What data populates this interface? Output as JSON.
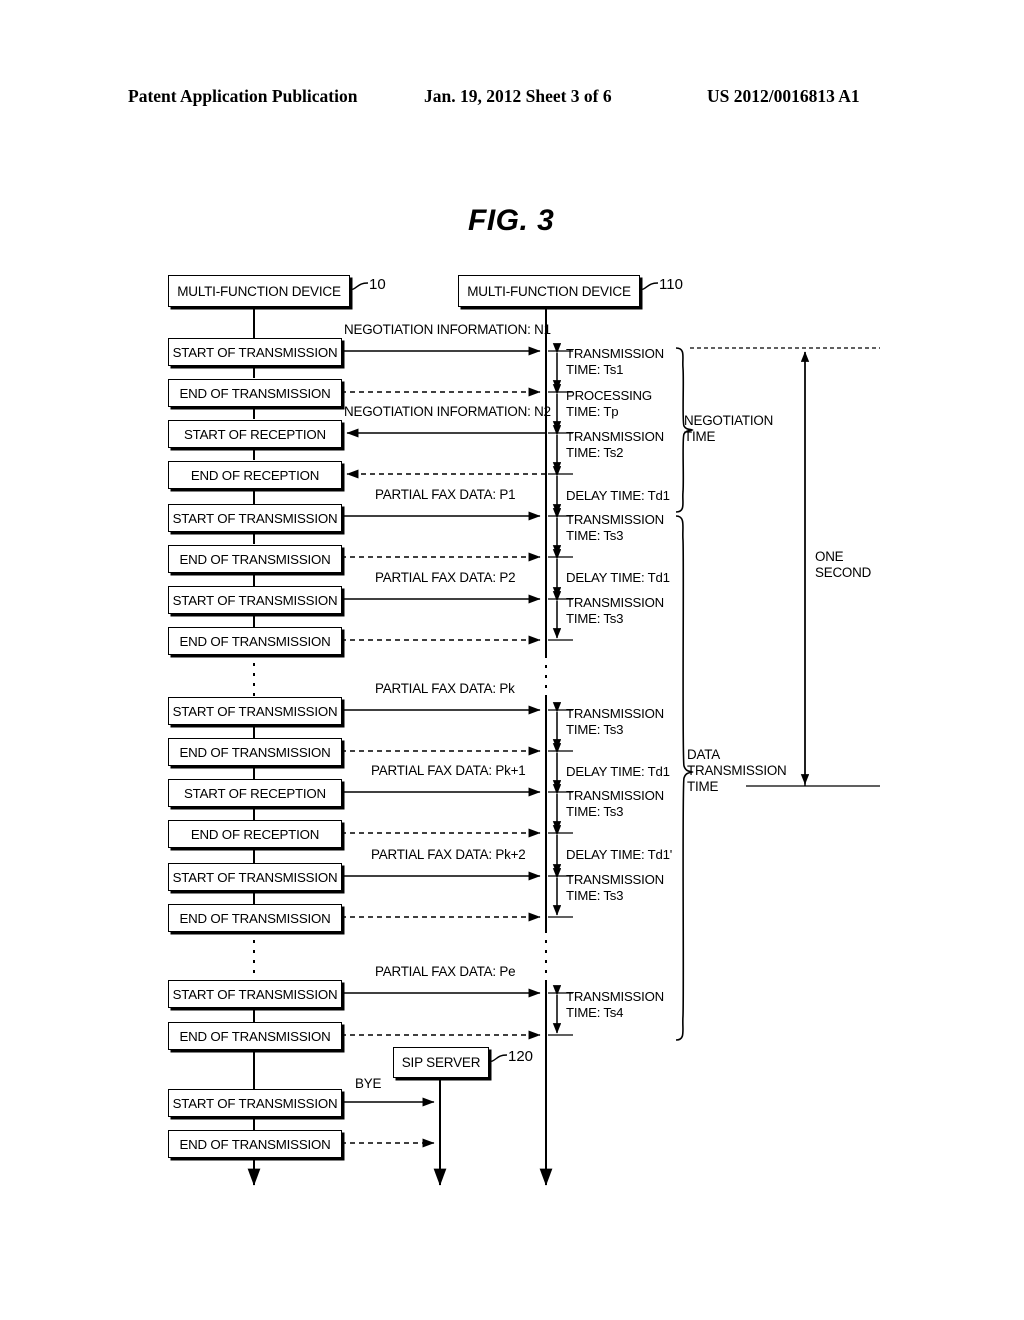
{
  "page_header": {
    "publication": "Patent Application Publication",
    "date_sheet": "Jan. 19, 2012  Sheet 3 of 6",
    "patent_number": "US 2012/0016813 A1"
  },
  "figure": {
    "title": "FIG. 3",
    "actors": [
      {
        "label": "MULTI-FUNCTION DEVICE",
        "ref": "10"
      },
      {
        "label": "MULTI-FUNCTION DEVICE",
        "ref": "110"
      },
      {
        "label": "SIP SERVER",
        "ref": "120"
      }
    ],
    "steps": [
      {
        "id": "s1",
        "label": "START OF TRANSMISSION"
      },
      {
        "id": "s2",
        "label": "END OF TRANSMISSION"
      },
      {
        "id": "s3",
        "label": "START OF RECEPTION"
      },
      {
        "id": "s4",
        "label": "END OF RECEPTION"
      },
      {
        "id": "s5",
        "label": "START OF TRANSMISSION"
      },
      {
        "id": "s6",
        "label": "END OF TRANSMISSION"
      },
      {
        "id": "s7",
        "label": "START OF TRANSMISSION"
      },
      {
        "id": "s8",
        "label": "END OF TRANSMISSION"
      },
      {
        "id": "s9",
        "label": "START OF TRANSMISSION"
      },
      {
        "id": "s10",
        "label": "END OF TRANSMISSION"
      },
      {
        "id": "s11",
        "label": "START OF RECEPTION"
      },
      {
        "id": "s12",
        "label": "END OF RECEPTION"
      },
      {
        "id": "s13",
        "label": "START OF TRANSMISSION"
      },
      {
        "id": "s14",
        "label": "END OF TRANSMISSION"
      },
      {
        "id": "s15",
        "label": "START OF TRANSMISSION"
      },
      {
        "id": "s16",
        "label": "END OF TRANSMISSION"
      },
      {
        "id": "s17",
        "label": "START OF TRANSMISSION"
      },
      {
        "id": "s18",
        "label": "END OF TRANSMISSION"
      }
    ],
    "messages": [
      {
        "id": "m1",
        "label": "NEGOTIATION INFORMATION: N1"
      },
      {
        "id": "m2",
        "label": "NEGOTIATION INFORMATION: N2"
      },
      {
        "id": "m3",
        "label": "PARTIAL FAX DATA: P1"
      },
      {
        "id": "m4",
        "label": "PARTIAL FAX DATA: P2"
      },
      {
        "id": "m5",
        "label": "PARTIAL FAX DATA: Pk"
      },
      {
        "id": "m6",
        "label": "PARTIAL FAX DATA: Pk+1"
      },
      {
        "id": "m7",
        "label": "PARTIAL FAX DATA: Pk+2"
      },
      {
        "id": "m8",
        "label": "PARTIAL FAX DATA: Pe"
      },
      {
        "id": "m9",
        "label": "BYE"
      }
    ],
    "timings": [
      {
        "id": "t1",
        "line1": "TRANSMISSION",
        "line2": "TIME: Ts1"
      },
      {
        "id": "t2",
        "line1": "PROCESSING",
        "line2": "TIME: Tp"
      },
      {
        "id": "t3",
        "line1": "TRANSMISSION",
        "line2": "TIME: Ts2"
      },
      {
        "id": "t4",
        "line1": "DELAY TIME: Td1",
        "line2": ""
      },
      {
        "id": "t5",
        "line1": "TRANSMISSION",
        "line2": "TIME: Ts3"
      },
      {
        "id": "t6",
        "line1": "DELAY TIME: Td1",
        "line2": ""
      },
      {
        "id": "t7",
        "line1": "TRANSMISSION",
        "line2": "TIME: Ts3"
      },
      {
        "id": "t8",
        "line1": "TRANSMISSION",
        "line2": "TIME: Ts3"
      },
      {
        "id": "t9",
        "line1": "DELAY TIME: Td1",
        "line2": ""
      },
      {
        "id": "t10",
        "line1": "TRANSMISSION",
        "line2": "TIME: Ts3"
      },
      {
        "id": "t11",
        "line1": "DELAY TIME: Td1'",
        "line2": ""
      },
      {
        "id": "t12",
        "line1": "TRANSMISSION",
        "line2": "TIME: Ts3"
      },
      {
        "id": "t13",
        "line1": "TRANSMISSION",
        "line2": "TIME: Ts4"
      }
    ],
    "brackets": [
      {
        "id": "b1",
        "line1": "NEGOTIATION",
        "line2": "TIME",
        "line3": ""
      },
      {
        "id": "b2",
        "line1": "DATA",
        "line2": "TRANSMISSION",
        "line3": "TIME"
      }
    ],
    "span": {
      "line1": "ONE",
      "line2": "SECOND"
    }
  }
}
